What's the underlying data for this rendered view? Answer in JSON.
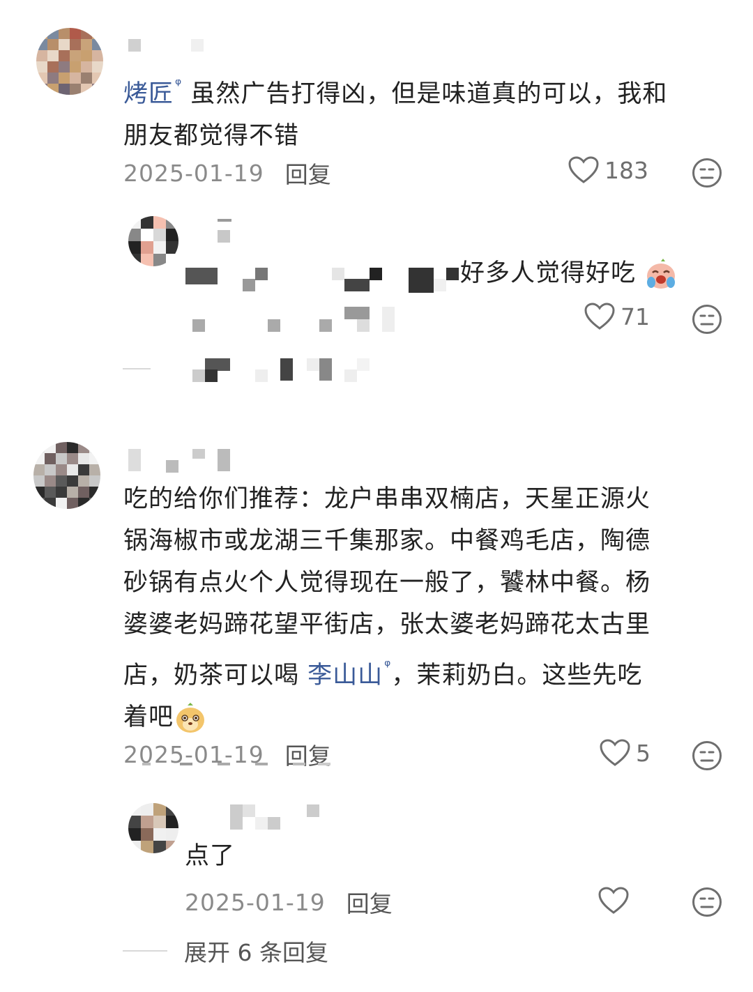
{
  "comments": [
    {
      "mention": "烤匠",
      "mention_search_icon": "search-icon",
      "text": "虽然广告打得凶，但是味道真的可以，我和",
      "text_line2": "朋友都觉得不错",
      "date": "2025-01-19",
      "reply_label": "回复",
      "likes": "183",
      "reply": {
        "text": "好多人觉得好吃",
        "emoji": "crying-laugh-face-icon",
        "likes": "71"
      }
    },
    {
      "lines": [
        "吃的给你们推荐：龙户串串双楠店，天星正源火",
        "锅海椒市或龙湖三千集那家。中餐鸡毛店，陶德",
        "砂锅有点火个人觉得现在一般了，饕林中餐。杨",
        "婆婆老妈蹄花望平街店，张太婆老妈蹄花太古里"
      ],
      "line5_before": "店，奶茶可以喝 ",
      "line5_mention": "李山山",
      "line5_after": "，茉莉奶白。这些先吃",
      "line6": "着吧",
      "emoji": "dog-face-icon",
      "date": "2025-01-19",
      "reply_label": "回复",
      "likes": "5",
      "reply": {
        "text": "点了",
        "date": "2025-01-19",
        "reply_label": "回复",
        "likes": ""
      },
      "expand_label": "展开 6 条回复"
    }
  ],
  "colors": {
    "mention": "#3a5a98",
    "meta": "#8a8a8a",
    "text": "#222222"
  }
}
